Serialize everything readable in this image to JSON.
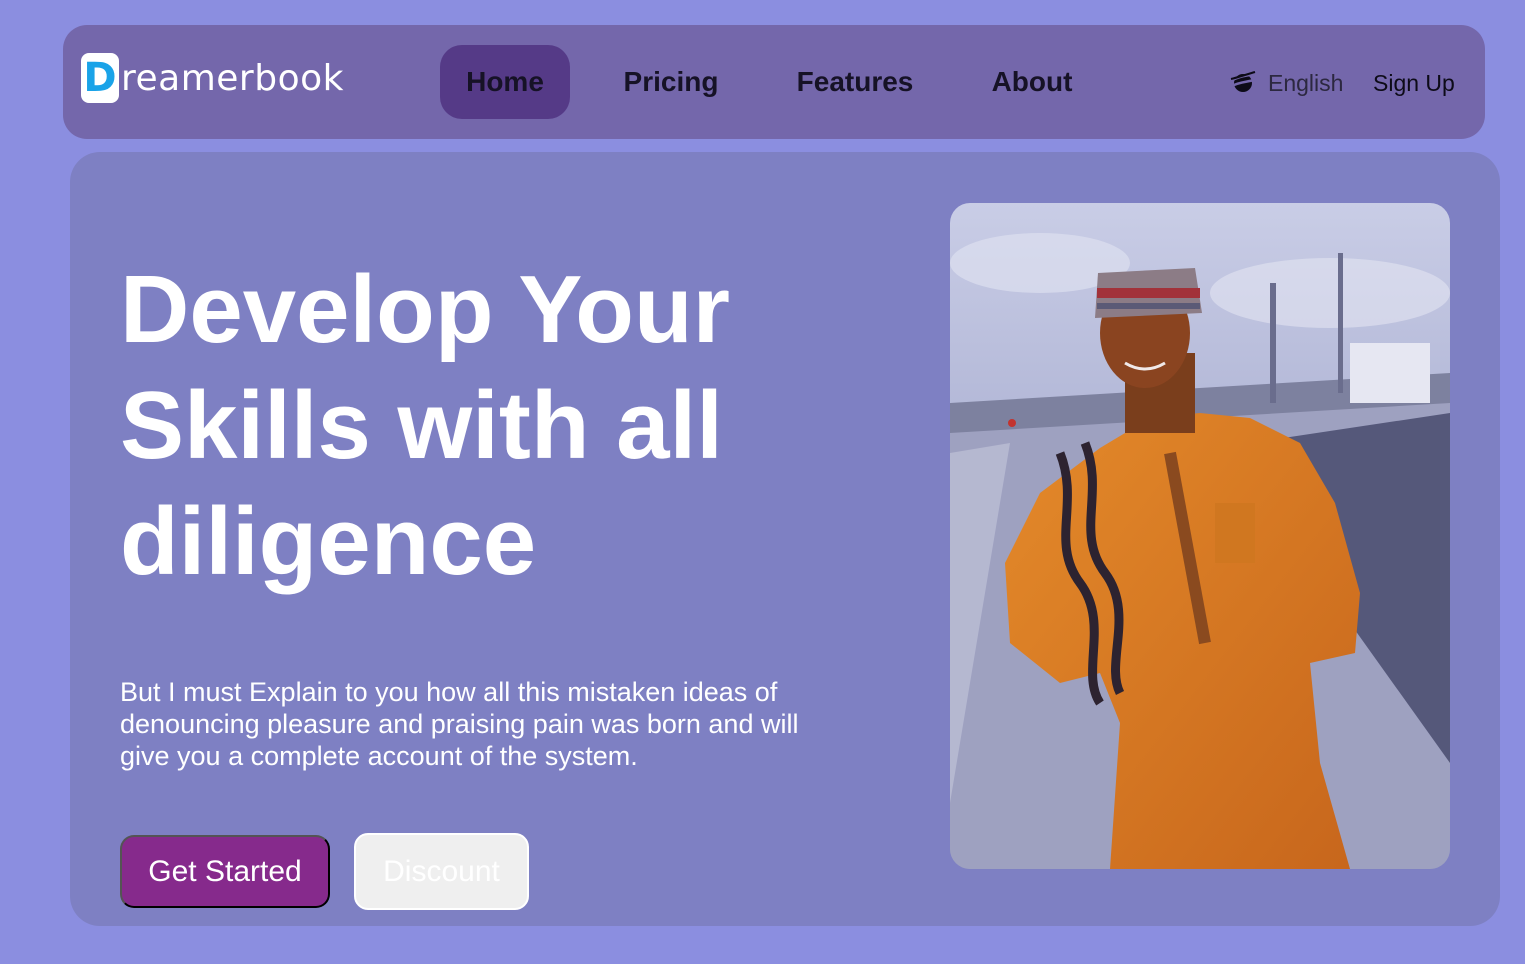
{
  "brand": {
    "logo_letter": "D",
    "logo_rest": "reamerbook"
  },
  "nav": {
    "items": [
      {
        "label": "Home",
        "active": true
      },
      {
        "label": "Pricing",
        "active": false
      },
      {
        "label": "Features",
        "active": false
      },
      {
        "label": "About",
        "active": false
      }
    ],
    "language": {
      "label": "English",
      "icon": "globe-icon"
    },
    "signup_label": "Sign Up"
  },
  "hero": {
    "headline_lines": [
      "Develop Your",
      "Skills with all",
      "diligence"
    ],
    "description": "But I must Explain to you how all this mistaken ideas of denouncing pleasure and praising pain was born and will give you a complete account of the system.",
    "primary_button": "Get Started",
    "secondary_button": "Discount"
  },
  "colors": {
    "page_bg": "#8b8ee0",
    "navbar_bg": "#7467ab",
    "active_nav_bg": "#553a87",
    "hero_bg": "#7e80c3",
    "primary_button_bg": "#862a8c",
    "logo_accent": "#1aa3e8"
  }
}
